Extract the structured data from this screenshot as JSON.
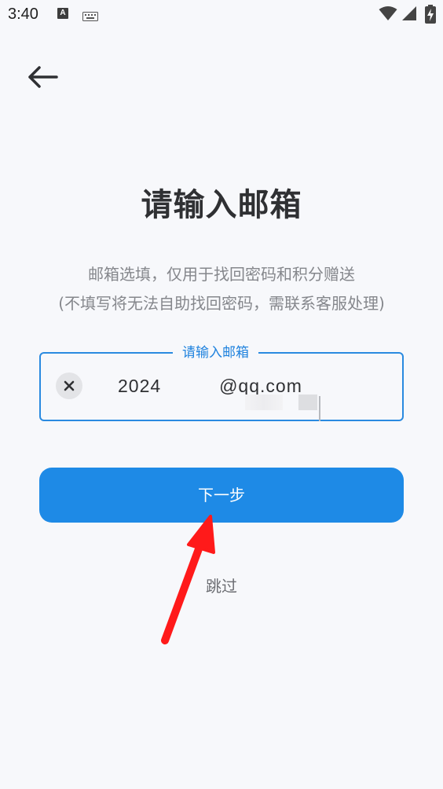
{
  "status_bar": {
    "time": "3:40",
    "notification_icon_letter": "A",
    "icons": [
      "a-notification-icon",
      "keyboard-icon",
      "wifi-icon",
      "signal-icon",
      "battery-charging-icon"
    ]
  },
  "header": {
    "back_icon": "arrow-left-icon"
  },
  "main": {
    "title": "请输入邮箱",
    "subtitle_line1": "邮箱选填，仅用于找回密码和积分赠送",
    "subtitle_line2": "(不填写将无法自助找回密码，需联系客服处理)"
  },
  "email_input": {
    "label": "请输入邮箱",
    "value_prefix": "2024",
    "value_suffix": "@qq.com",
    "clear_icon": "close-icon"
  },
  "actions": {
    "next_label": "下一步",
    "skip_label": "跳过"
  },
  "colors": {
    "accent": "#1e8ae6",
    "background": "#f7f8fb",
    "annotation": "#ff1a1a"
  }
}
